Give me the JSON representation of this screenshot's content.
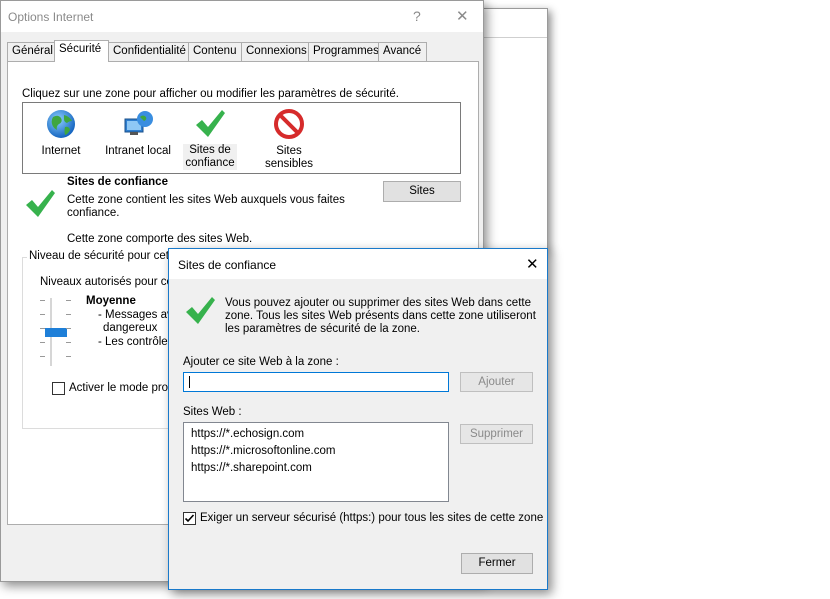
{
  "options": {
    "title": "Options Internet",
    "help_label": "?",
    "close_label": "✕",
    "tabs": [
      "Général",
      "Sécurité",
      "Confidentialité",
      "Contenu",
      "Connexions",
      "Programmes",
      "Avancé"
    ],
    "instruction": "Cliquez sur une zone pour afficher ou modifier les paramètres de sécurité.",
    "zones": [
      {
        "label": "Internet",
        "icon": "globe-icon"
      },
      {
        "label": "Intranet local",
        "icon": "intranet-icon"
      },
      {
        "label1": "Sites de",
        "label2": "confiance",
        "icon": "checkmark-icon"
      },
      {
        "label": "Sites sensibles",
        "icon": "blocked-icon"
      }
    ],
    "zone_title": "Sites de confiance",
    "zone_desc1": "Cette zone contient les sites Web auxquels vous faites",
    "zone_desc2": "confiance.",
    "zone_desc3": "Cette zone comporte des sites Web.",
    "sites_button": "Sites",
    "security_level_legend": "Niveau de sécurité pour cette",
    "allowed_levels": "Niveaux autorisés pour cette",
    "level_name": "Moyenne",
    "level_line1": "- Messages ava",
    "level_line2": "dangereux",
    "level_line3": "- Les contrôles",
    "protected_mode": "Activer le mode protég"
  },
  "trusted_sites": {
    "title": "Sites de confiance",
    "close_label": "✕",
    "info1": "Vous pouvez ajouter ou supprimer des sites Web dans cette",
    "info2": "zone. Tous les sites Web présents dans cette zone utiliseront",
    "info3": "les paramètres de sécurité de la zone.",
    "add_label": "Ajouter ce site Web à la zone :",
    "add_value": "",
    "add_button": "Ajouter",
    "sites_label": "Sites Web :",
    "sites": [
      "https://*.echosign.com",
      "https://*.microsoftonline.com",
      "https://*.sharepoint.com"
    ],
    "remove_button": "Supprimer",
    "require_https": "Exiger un serveur sécurisé (https:) pour tous les sites de cette zone",
    "require_https_checked": true,
    "close_button": "Fermer"
  }
}
